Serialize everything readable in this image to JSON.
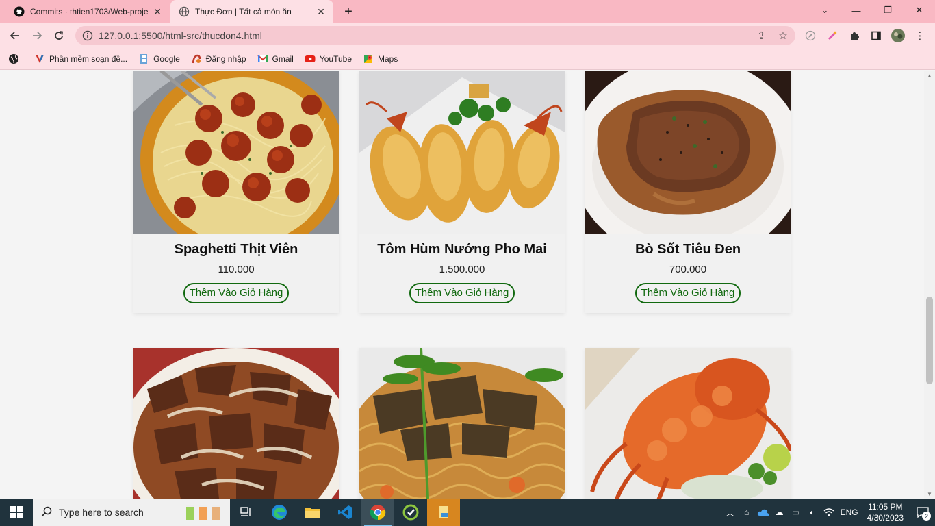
{
  "browser": {
    "tabs": [
      {
        "title": "Commits · thtien1703/Web-proje",
        "icon": "github-icon",
        "active": false
      },
      {
        "title": "Thực Đơn | Tất cả món ăn",
        "icon": "globe-icon",
        "active": true
      }
    ],
    "new_tab": "+",
    "window_controls": {
      "dropdown": "⌄",
      "minimize": "—",
      "restore": "❐",
      "close": "✕"
    },
    "url": "127.0.0.1:5500/html-src/thucdon4.html",
    "bookmarks": [
      {
        "label": "",
        "icon": "globe-icon"
      },
      {
        "label": "Phần mềm soạn đề...",
        "icon": "v-logo-icon"
      },
      {
        "label": "Google",
        "icon": "google-icon"
      },
      {
        "label": "Đăng nhập",
        "icon": "login-icon"
      },
      {
        "label": "Gmail",
        "icon": "gmail-icon"
      },
      {
        "label": "YouTube",
        "icon": "youtube-icon"
      },
      {
        "label": "Maps",
        "icon": "maps-icon"
      }
    ]
  },
  "menu": {
    "items": [
      {
        "name": "Spaghetti Thịt Viên",
        "price": "110.000",
        "button": "Thêm Vào Giỏ Hàng"
      },
      {
        "name": "Tôm Hùm Nướng Pho Mai",
        "price": "1.500.000",
        "button": "Thêm Vào Giỏ Hàng"
      },
      {
        "name": "Bò Sốt Tiêu Đen",
        "price": "700.000",
        "button": "Thêm Vào Giỏ Hàng"
      }
    ]
  },
  "taskbar": {
    "search_placeholder": "Type here to search",
    "language": "ENG",
    "time": "11:05 PM",
    "date": "4/30/2023",
    "notification_count": "2"
  },
  "colors": {
    "tab_strip": "#f9b8c3",
    "toolbar": "#fde0e5",
    "button_green": "#11690f",
    "taskbar": "#20333d"
  }
}
